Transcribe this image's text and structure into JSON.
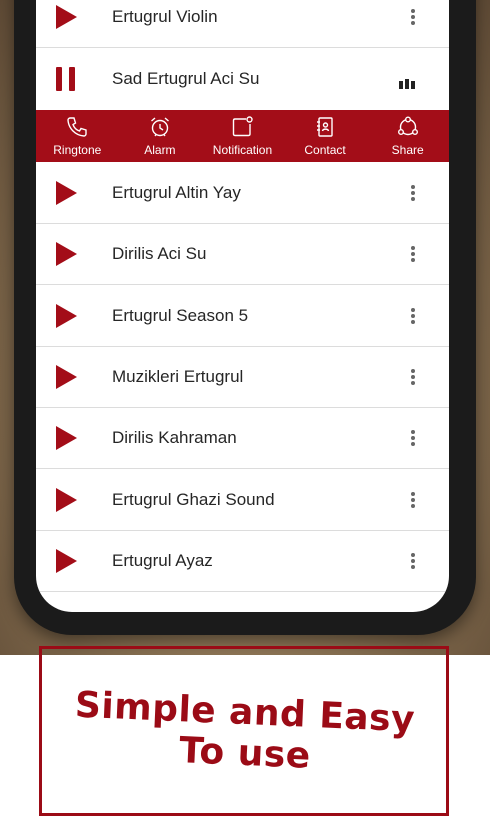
{
  "tracks": [
    {
      "title": "Ertugrul Violin",
      "state": "play"
    },
    {
      "title": "Sad Ertugrul Aci Su",
      "state": "playing"
    },
    {
      "title": "Ertugrul Altin Yay",
      "state": "play"
    },
    {
      "title": "Dirilis Aci Su",
      "state": "play"
    },
    {
      "title": "Ertugrul Season 5",
      "state": "play"
    },
    {
      "title": "Muzikleri Ertugrul",
      "state": "play"
    },
    {
      "title": "Dirilis Kahraman",
      "state": "play"
    },
    {
      "title": "Ertugrul Ghazi Sound",
      "state": "play"
    },
    {
      "title": "Ertugrul Ayaz",
      "state": "play"
    }
  ],
  "actions": [
    {
      "label": "Ringtone",
      "icon": "phone-icon"
    },
    {
      "label": "Alarm",
      "icon": "alarm-clock-icon"
    },
    {
      "label": "Notification",
      "icon": "notification-icon"
    },
    {
      "label": "Contact",
      "icon": "contact-book-icon"
    },
    {
      "label": "Share",
      "icon": "share-icon"
    }
  ],
  "promo": {
    "line1": "Simple and Easy",
    "line2": "To use"
  },
  "colors": {
    "accent": "#a30d18",
    "text": "#262626",
    "divider": "#dcdcdc"
  }
}
